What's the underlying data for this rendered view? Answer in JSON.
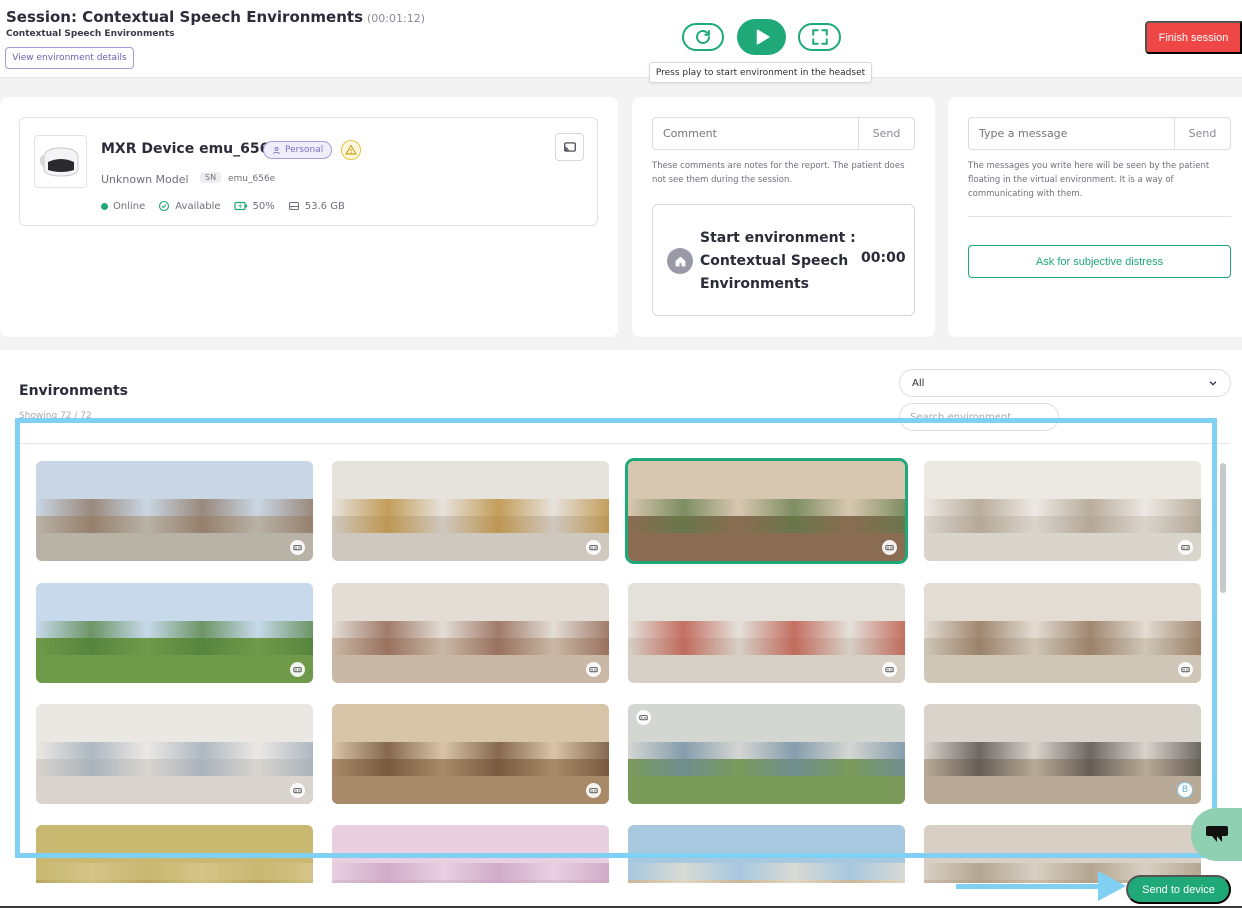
{
  "header": {
    "title": "Session: Contextual Speech Environments",
    "timer": "(00:01:12)",
    "subtitle": "Contextual Speech Environments",
    "view_details_label": "View environment details",
    "tooltip": "Press play to start environment in the headset",
    "finish_label": "Finish session"
  },
  "device": {
    "name": "MXR Device emu_656e",
    "badge": "Personal",
    "model": "Unknown Model",
    "sn_label": "SN",
    "sn_value": "emu_656e",
    "status": "Online",
    "availability": "Available",
    "battery": "50%",
    "storage": "53.6 GB"
  },
  "comment": {
    "placeholder": "Comment",
    "send_label": "Send",
    "note": "These comments are notes for the report. The patient does not see them during the session.",
    "start_title": "Start environment : Contextual Speech Environments",
    "start_time": "00:00"
  },
  "message": {
    "placeholder": "Type a message",
    "send_label": "Send",
    "note": "The messages you write here will be seen by the patient floating in the virtual environment. It is a way of communicating with them.",
    "distress_label": "Ask for subjective distress"
  },
  "environments": {
    "title": "Environments",
    "count": "Showing 72 / 72",
    "filter_value": "All",
    "search_placeholder": "Search environment",
    "send_label": "Send to device",
    "thumbnails": [
      {
        "sky": "#c9d6e3",
        "ground": "#b9b2a6",
        "strip": "#8a6f5a",
        "badge": "vr"
      },
      {
        "sky": "#e6e2dc",
        "ground": "#cfc8be",
        "strip": "#b8862e",
        "badge": "vr"
      },
      {
        "sky": "#d8c7b0",
        "ground": "#8a6c52",
        "strip": "#5f7a48",
        "badge": "vr",
        "selected": true
      },
      {
        "sky": "#ece8e2",
        "ground": "#d9d4cc",
        "strip": "#a89a86",
        "badge": "vr"
      },
      {
        "sky": "#c7d9ea",
        "ground": "#6f9a4a",
        "strip": "#4e7e3a",
        "badge": "vr"
      },
      {
        "sky": "#e3ddd5",
        "ground": "#c9b8a6",
        "strip": "#8a5a46",
        "badge": "vr"
      },
      {
        "sky": "#e4e1db",
        "ground": "#d6d0c6",
        "strip": "#b84a3a",
        "badge": "vr"
      },
      {
        "sky": "#e2dcd2",
        "ground": "#cfc6b8",
        "strip": "#8a6a4e",
        "badge": "vr"
      },
      {
        "sky": "#ebe8e4",
        "ground": "#d9d4ce",
        "strip": "#9aa8b6",
        "badge": "vr"
      },
      {
        "sky": "#d8c4a8",
        "ground": "#a88a68",
        "strip": "#6a4a32",
        "badge": "vr"
      },
      {
        "sky": "#d4d6d2",
        "ground": "#7a9a5a",
        "strip": "#6c8aa0",
        "badge": "vr-tl"
      },
      {
        "sky": "#d8d4cc",
        "ground": "#b8aa96",
        "strip": "#4a4440",
        "badge": "b"
      },
      {
        "sky": "#c8b870",
        "ground": "#b8a860",
        "strip": "#d8c890",
        "badge": "none"
      },
      {
        "sky": "#e8d0e0",
        "ground": "#d8c0d0",
        "strip": "#c8a0c0",
        "badge": "none"
      },
      {
        "sky": "#a8c8e0",
        "ground": "#c8b898",
        "strip": "#e8e0d0",
        "badge": "none"
      },
      {
        "sky": "#d8d0c4",
        "ground": "#c8bca8",
        "strip": "#a89880",
        "badge": "none"
      }
    ]
  },
  "colors": {
    "accent": "#1fa878",
    "danger": "#ef4646",
    "highlight": "#7fd0f2",
    "purple": "#a69ad8"
  }
}
